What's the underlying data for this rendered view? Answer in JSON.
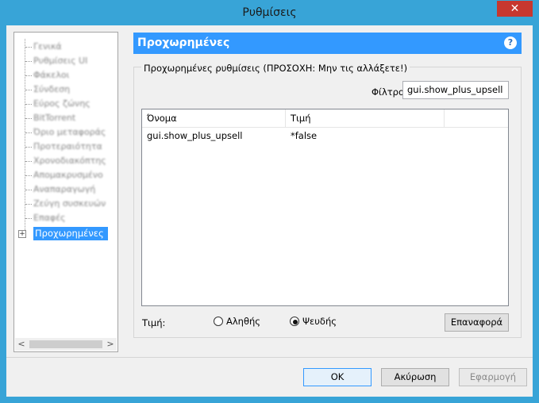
{
  "window": {
    "title": "Ρυθμίσεις",
    "close_glyph": "✕"
  },
  "tree": {
    "items": [
      {
        "label": "Γενικά"
      },
      {
        "label": "Ρυθμίσεις UI"
      },
      {
        "label": "Φάκελοι"
      },
      {
        "label": "Σύνδεση"
      },
      {
        "label": "Εύρος ζώνης"
      },
      {
        "label": "BitTorrent"
      },
      {
        "label": "Όριο μεταφοράς"
      },
      {
        "label": "Προτεραιότητα"
      },
      {
        "label": "Χρονοδιακόπτης"
      },
      {
        "label": "Απομακρυσμένο"
      },
      {
        "label": "Αναπαραγωγή"
      },
      {
        "label": "Ζεύγη συσκευών"
      },
      {
        "label": "Επαφές"
      }
    ],
    "selected": {
      "label": "Προχωρημένες",
      "expander": "+"
    },
    "scroll_left": "<",
    "scroll_right": ">"
  },
  "panel": {
    "title": "Προχωρημένες",
    "help_icon": "?",
    "group_title": "Προχωρημένες ρυθμίσεις (ΠΡΟΣΟΧΗ: Μην τις αλλάξετε!)",
    "filter": {
      "label": "Φίλτρο",
      "value": "gui.show_plus_upsell"
    },
    "table": {
      "columns": [
        "Όνομα",
        "Τιμή"
      ],
      "rows": [
        {
          "name": "gui.show_plus_upsell",
          "value": "*false"
        }
      ]
    },
    "value_label": "Τιμή:",
    "radios": [
      {
        "label": "Αληθής",
        "checked": false
      },
      {
        "label": "Ψευδής",
        "checked": true
      }
    ],
    "reset_button": "Επαναφορά"
  },
  "footer": {
    "ok": "OK",
    "cancel": "Ακύρωση",
    "apply": "Εφαρμογή"
  }
}
